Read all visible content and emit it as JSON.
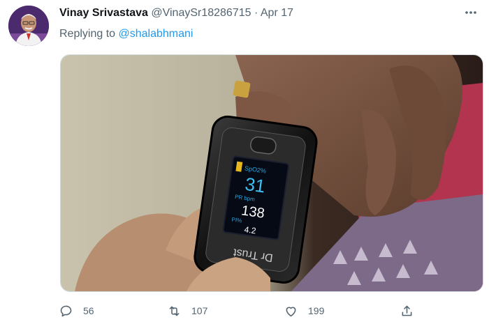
{
  "tweet": {
    "author_name": "Vinay Srivastava",
    "author_handle": "@VinaySr18286715",
    "separator": "·",
    "date": "Apr 17",
    "reply_prefix": "Replying to",
    "reply_mention": "@shalabhmani"
  },
  "device": {
    "spo2_label": "SpO2%",
    "spo2_value": "31",
    "pr_label": "PR bpm",
    "pr_value": "138",
    "pi_label": "PI%",
    "pi_value": "4.2",
    "brand": "Dr Trust"
  },
  "actions": {
    "reply_count": "56",
    "retweet_count": "107",
    "like_count": "199"
  },
  "icons": [
    "more-options-icon",
    "reply-icon",
    "retweet-icon",
    "like-icon",
    "share-icon"
  ],
  "colors": {
    "link": "#1d9bf0",
    "muted": "#536471",
    "text": "#0f1419"
  }
}
